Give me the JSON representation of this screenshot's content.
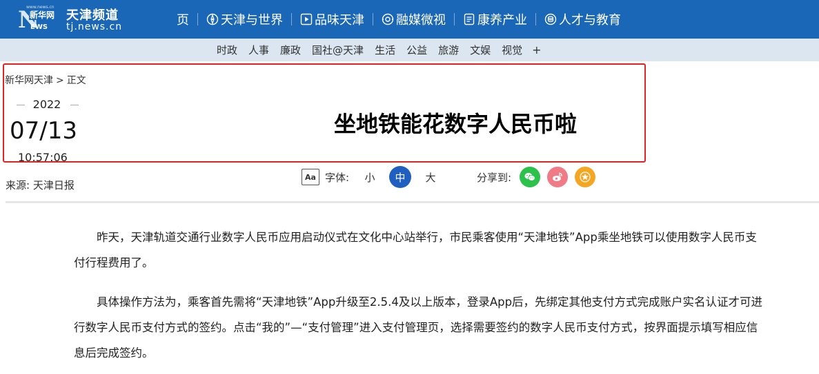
{
  "logo": {
    "small_text": "www.news.cn",
    "mark_letter": "N",
    "mark_brand": "新华网",
    "mark_letters": "EWS",
    "title": "天津频道",
    "url": "tj.news.cn"
  },
  "main_nav": [
    {
      "label": "页",
      "icon": ""
    },
    {
      "label": "天津与世界",
      "icon": "compass-icon"
    },
    {
      "label": "品味天津",
      "icon": "play-icon"
    },
    {
      "label": "融媒微视",
      "icon": "media-icon"
    },
    {
      "label": "康养产业",
      "icon": "document-icon"
    },
    {
      "label": "人才与教育",
      "icon": "coins-icon"
    }
  ],
  "sub_nav": [
    "时政",
    "人事",
    "廉政",
    "国社@天津",
    "生活",
    "公益",
    "旅游",
    "文娱",
    "视觉",
    "+"
  ],
  "breadcrumb": {
    "home": "新华网天津",
    "arrow": ">",
    "current": "正文"
  },
  "date": {
    "year": "2022",
    "month_day": "07/13",
    "time": "10:57:06"
  },
  "article_title": "坐地铁能花数字人民币啦",
  "source": "来源: 天津日报",
  "font_control": {
    "icon_text": "Aa",
    "label": "字体:",
    "small": "小",
    "medium": "中",
    "large": "大",
    "selected": "中"
  },
  "share": {
    "label": "分享到:",
    "buttons": [
      {
        "name": "wechat",
        "color": "#2cc14a"
      },
      {
        "name": "weibo",
        "color": "#f07b86"
      },
      {
        "name": "favorite",
        "color": "#f5a623"
      }
    ]
  },
  "paragraphs": [
    "昨天，天津轨道交通行业数字人民币应用启动仪式在文化中心站举行，市民乘客使用“天津地铁”App乘坐地铁可以使用数字人民币支付行程费用了。",
    "具体操作方法为，乘客首先需将“天津地铁”App升级至2.5.4及以上版本，登录App后，先绑定其他支付方式完成账户实名认证才可进行数字人民币支付方式的签约。点击“我的”—“支付管理”进入支付管理页，选择需要签约的数字人民币支付方式，按界面提示填写相应信息后完成签约。"
  ],
  "colors": {
    "topbar": "#1a66b7",
    "subnav": "#dbe6f1",
    "highlight_border": "#e52222",
    "active_size": "#1f5fbf"
  }
}
